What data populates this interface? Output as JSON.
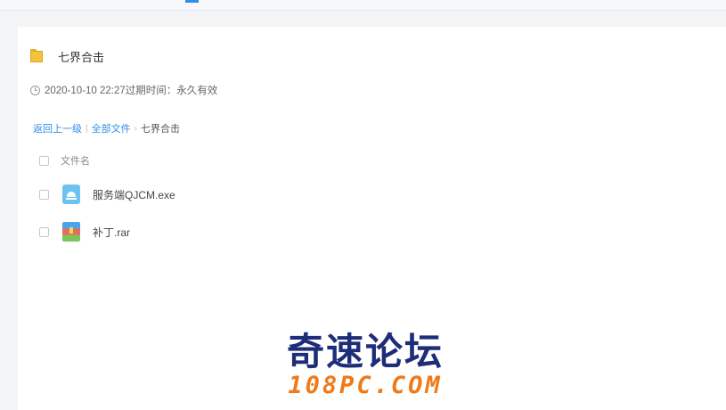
{
  "folder": {
    "title": "七界合击",
    "meta": "2020-10-10 22:27过期时间：永久有效"
  },
  "breadcrumb": {
    "back": "返回上一级",
    "all_files": "全部文件",
    "current": "七界合击"
  },
  "file_list": {
    "column_name": "文件名",
    "files": [
      {
        "name": "服务端QJCM.exe",
        "icon": "exe-file-icon"
      },
      {
        "name": "补丁.rar",
        "icon": "rar-archive-icon"
      }
    ]
  },
  "watermark": {
    "cn": "奇速论坛",
    "en": "108PC.COM"
  },
  "colors": {
    "accent": "#2f8ee8",
    "watermark_blue": "#1e2d78",
    "watermark_orange": "#f07a1a"
  }
}
